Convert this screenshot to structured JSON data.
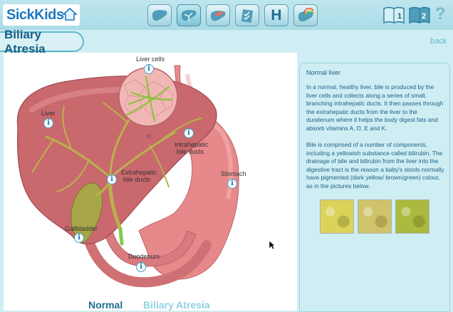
{
  "header": {
    "logo_text": "SickKids",
    "nav_buttons": [
      {
        "name": "liver-icon"
      },
      {
        "name": "liver-ducts-icon"
      },
      {
        "name": "liver-pills-icon"
      },
      {
        "name": "checklist-icon"
      },
      {
        "name": "hospital-icon",
        "label": "H"
      },
      {
        "name": "liver-rainbow-icon"
      }
    ],
    "book_1_label": "1",
    "book_2_label": "2",
    "help_label": "?"
  },
  "page": {
    "title": "Biliary Atresia",
    "back_label": "back"
  },
  "diagram": {
    "labels": {
      "liver_cells": "Liver cells",
      "liver": "Liver",
      "intrahepatic_1": "Intrahepatic",
      "intrahepatic_2": "bile ducts",
      "extrahepatic_1": "Extrahepatic",
      "extrahepatic_2": "bile ducts",
      "stomach": "Stomach",
      "gallbladder": "Gallbladder",
      "duodenum": "Duodenum"
    },
    "info_glyph": "i"
  },
  "panel": {
    "heading": "Normal liver",
    "paragraph_1": "In a normal, healthy liver, bile is produced by the liver cells and collects along a series of small, branching intrahepatic ducts. It then passes through the extrahepatic ducts from the liver to the duodenum where it helps the body digest fats and absorb vitamins A, D, E and K.",
    "paragraph_2": "Bile is comprised of a number of components, including a yellowish substance called bilirubin. The drainage of bile and bilirubin from the liver into the digestive tract is the reason a baby's stools normally have pigmented (dark yellow/ brown/green) colour, as in the pictures below.",
    "stool_colors": [
      "#d9d35a",
      "#cfc46a",
      "#a9ba3e"
    ]
  },
  "tabs": {
    "normal": "Normal",
    "biliary": "Biliary Atresia"
  },
  "colors": {
    "accent": "#1e78bf",
    "title": "#1a5f86",
    "liver": "#c96a6f",
    "duct": "#b9b24c"
  }
}
